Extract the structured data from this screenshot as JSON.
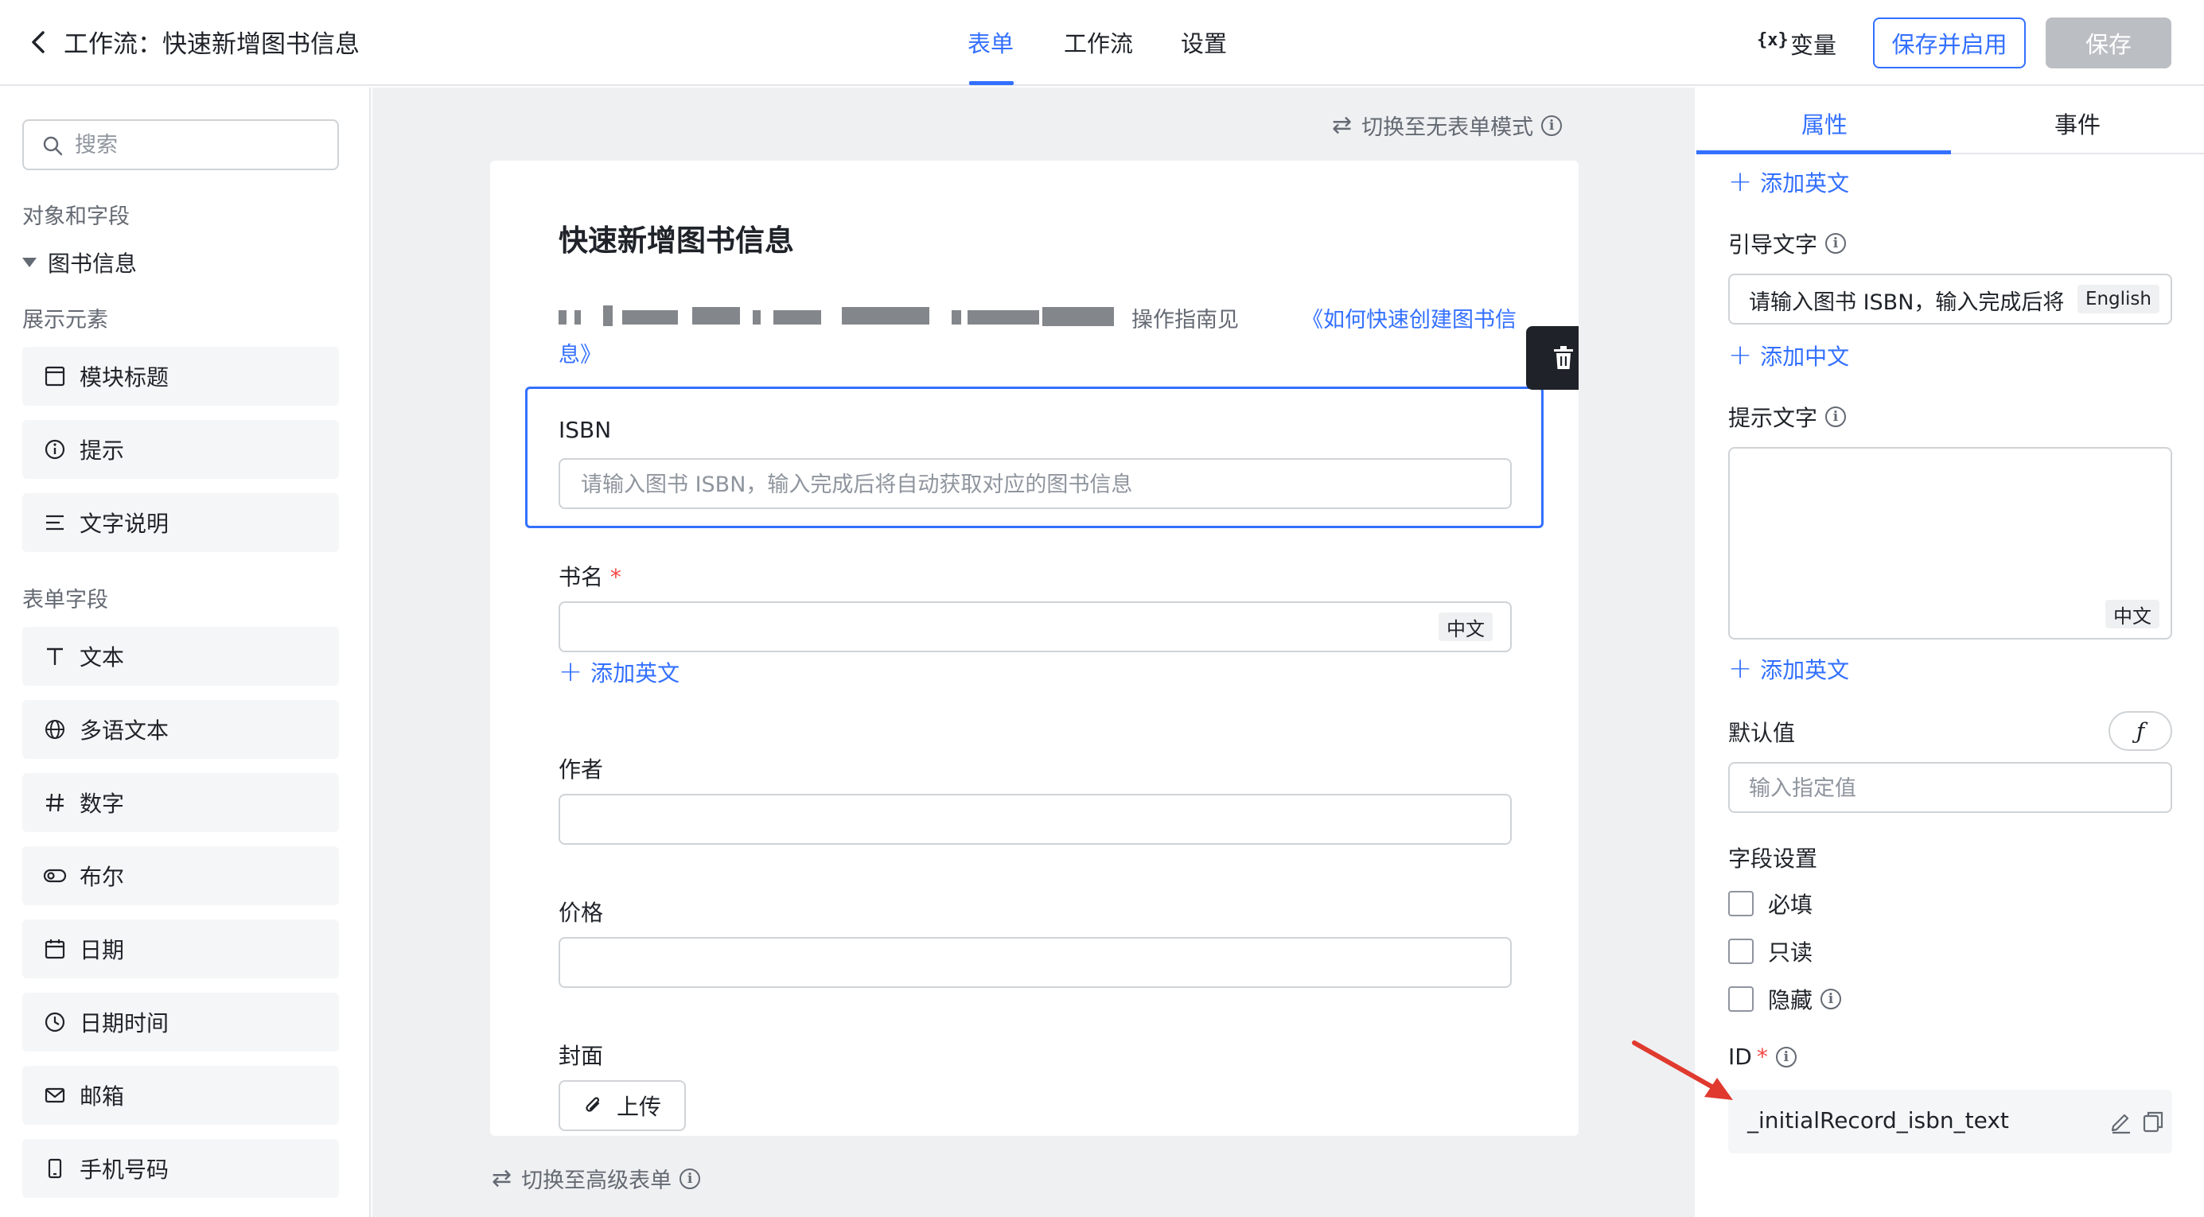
{
  "header": {
    "title": "工作流：快速新增图书信息",
    "tabs": [
      {
        "label": "表单",
        "active": true
      },
      {
        "label": "工作流",
        "active": false
      },
      {
        "label": "设置",
        "active": false
      }
    ],
    "variables_icon": "{x}",
    "variables_label": "变量",
    "save_and_enable_label": "保存并启用",
    "save_label": "保存"
  },
  "sidebar": {
    "search_placeholder": "搜索",
    "section_objects": "对象和字段",
    "tree_node": "图书信息",
    "section_display": "展示元素",
    "display_items": [
      {
        "label": "模块标题",
        "icon": "title-block-icon"
      },
      {
        "label": "提示",
        "icon": "info-icon"
      },
      {
        "label": "文字说明",
        "icon": "text-lines-icon"
      }
    ],
    "section_form_fields": "表单字段",
    "field_items": [
      {
        "label": "文本",
        "icon": "text-t-icon"
      },
      {
        "label": "多语文本",
        "icon": "globe-icon"
      },
      {
        "label": "数字",
        "icon": "hash-icon"
      },
      {
        "label": "布尔",
        "icon": "toggle-icon"
      },
      {
        "label": "日期",
        "icon": "calendar-icon"
      },
      {
        "label": "日期时间",
        "icon": "clock-icon"
      },
      {
        "label": "邮箱",
        "icon": "mail-icon"
      },
      {
        "label": "手机号码",
        "icon": "phone-icon"
      }
    ]
  },
  "canvas": {
    "switch_top": "切换至无表单模式",
    "switch_bottom": "切换至高级表单",
    "form": {
      "title": "快速新增图书信息",
      "guide_text": "操作指南见",
      "guide_link_1": "《如何快速创建图书信",
      "guide_link_2": "息》",
      "fields": {
        "isbn": {
          "label": "ISBN",
          "placeholder": "请输入图书 ISBN，输入完成后将自动获取对应的图书信息"
        },
        "book_name": {
          "label": "书名",
          "required_mark": "*",
          "lang_tag": "中文",
          "add_english": "添加英文"
        },
        "author": {
          "label": "作者"
        },
        "price": {
          "label": "价格"
        },
        "cover": {
          "label": "封面",
          "upload_label": "上传"
        }
      }
    }
  },
  "right_panel": {
    "tabs": [
      {
        "label": "属性",
        "active": true
      },
      {
        "label": "事件",
        "active": false
      }
    ],
    "add_english_1": "添加英文",
    "guide_text_label": "引导文字",
    "guide_text_value": "请输入图书 ISBN，输入完成后将",
    "guide_lang_tag": "English",
    "add_chinese": "添加中文",
    "hint_text_label": "提示文字",
    "hint_lang_tag": "中文",
    "add_english_2": "添加英文",
    "default_label": "默认值",
    "default_placeholder": "输入指定值",
    "fx_label": "ƒ",
    "field_settings_label": "字段设置",
    "checkboxes": [
      {
        "label": "必填",
        "checked": false,
        "info": false
      },
      {
        "label": "只读",
        "checked": false,
        "info": false
      },
      {
        "label": "隐藏",
        "checked": false,
        "info": true
      }
    ],
    "id_label": "ID",
    "id_required": "*",
    "id_value": "_initialRecord_isbn_text"
  },
  "colors": {
    "accent": "#3370ff",
    "disabled": "#bbbfc4",
    "required": "#f54a45",
    "annotation_arrow": "#e03a2f"
  }
}
